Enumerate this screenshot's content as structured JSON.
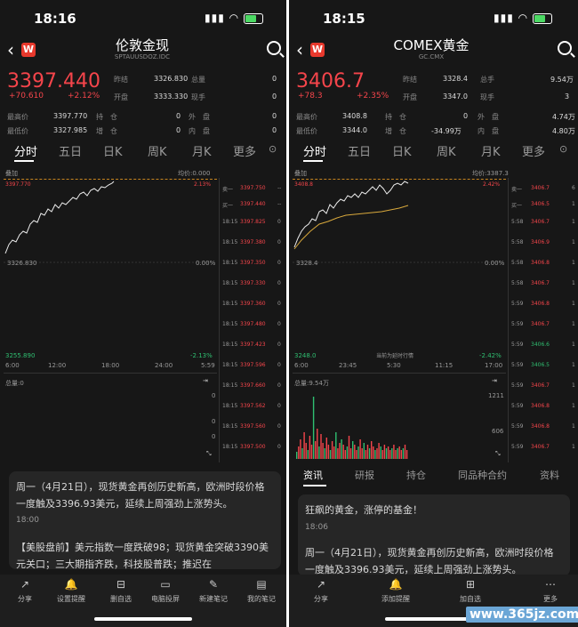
{
  "left": {
    "status_time": "18:16",
    "title": "伦敦金现",
    "subtitle": "SPTAUUSDOZ.IDC",
    "price": "3397.440",
    "change": "+70.610",
    "change_pct": "+2.12%",
    "stats": [
      {
        "label": "昨结",
        "value": "3326.830"
      },
      {
        "label": "总量",
        "value": "0"
      },
      {
        "label": "开盘",
        "value": "3333.330"
      },
      {
        "label": "现手",
        "value": "0"
      },
      {
        "label": "最高价",
        "value": "3397.770"
      },
      {
        "label": "持　仓",
        "value": "0"
      },
      {
        "label": "外　盘",
        "value": "0"
      },
      {
        "label": "最低价",
        "value": "3327.985"
      },
      {
        "label": "增　仓",
        "value": "0"
      },
      {
        "label": "内　盘",
        "value": "0"
      }
    ],
    "tabs": [
      "分时",
      "五日",
      "日K",
      "周K",
      "月K",
      "更多"
    ],
    "chart": {
      "overlay": "叠加",
      "avg": "均价:0.000",
      "hi": "3397.770",
      "hi_pct": "2.13%",
      "mid": "3326.830",
      "mid_pct": "0.00%",
      "lo": "3255.890",
      "lo_pct": "-2.13%",
      "xticks": [
        "6:00",
        "12:00",
        "18:00",
        "24:00",
        "5:59"
      ],
      "volume_label": "总量:0",
      "vol_ticks": [
        "0",
        "0",
        "0"
      ]
    },
    "bid_ask": [
      {
        "l": "卖一",
        "v": "3397.750",
        "r": "--"
      },
      {
        "l": "买一",
        "v": "3397.440",
        "r": "--"
      }
    ],
    "ticks": [
      {
        "t": "18:15",
        "v": "3397.825",
        "r": "0"
      },
      {
        "t": "18:15",
        "v": "3397.380",
        "r": "0"
      },
      {
        "t": "18:15",
        "v": "3397.350",
        "r": "0"
      },
      {
        "t": "18:15",
        "v": "3397.330",
        "r": "0"
      },
      {
        "t": "18:15",
        "v": "3397.360",
        "r": "0"
      },
      {
        "t": "18:15",
        "v": "3397.480",
        "r": "0"
      },
      {
        "t": "18:15",
        "v": "3397.423",
        "r": "0"
      },
      {
        "t": "18:15",
        "v": "3397.596",
        "r": "0"
      },
      {
        "t": "18:15",
        "v": "3397.660",
        "r": "0"
      },
      {
        "t": "18:15",
        "v": "3397.562",
        "r": "0"
      },
      {
        "t": "18:15",
        "v": "3397.560",
        "r": "0"
      },
      {
        "t": "18:15",
        "v": "3397.500",
        "r": "0"
      }
    ],
    "news1": "周一（4月21日），现货黄金再创历史新高，欧洲时段价格一度触及3396.93美元，延续上周强劲上涨势头。",
    "news1_time": "18:00",
    "news2": "【美股盘前】美元指数一度跌破98；现货黄金突破3390美元关口；三大期指齐跌，科技股普跌；推迟在",
    "bottom": [
      "分享",
      "设置提醒",
      "删自选",
      "电脑投屏",
      "新建笔记",
      "我的笔记"
    ]
  },
  "right": {
    "status_time": "18:15",
    "title": "COMEX黄金",
    "subtitle": "GC.CMX",
    "price": "3406.7",
    "change": "+78.3",
    "change_pct": "+2.35%",
    "stats": [
      {
        "label": "昨结",
        "value": "3328.4"
      },
      {
        "label": "总手",
        "value": "9.54万"
      },
      {
        "label": "开盘",
        "value": "3347.0"
      },
      {
        "label": "现手",
        "value": "3"
      },
      {
        "label": "最高价",
        "value": "3408.8"
      },
      {
        "label": "持　仓",
        "value": "0"
      },
      {
        "label": "外　盘",
        "value": "4.74万"
      },
      {
        "label": "最低价",
        "value": "3344.0"
      },
      {
        "label": "增　仓",
        "value": "-34.99万"
      },
      {
        "label": "内　盘",
        "value": "4.80万"
      }
    ],
    "tabs": [
      "分时",
      "五日",
      "日K",
      "周K",
      "月K",
      "更多"
    ],
    "chart": {
      "overlay": "叠加",
      "avg": "均价:3387.3",
      "hi": "3408.8",
      "hi_pct": "2.42%",
      "mid": "3328.4",
      "mid_pct": "0.00%",
      "lo": "3248.0",
      "lo_pct": "-2.42%",
      "xticks": [
        "6:00",
        "23:45",
        "5:30",
        "11:15",
        "17:00"
      ],
      "note": "当前为延时行情",
      "volume_label": "总量:9.54万",
      "vol_ticks": [
        "1211",
        "606"
      ]
    },
    "bid_ask": [
      {
        "l": "卖一",
        "v": "3406.7",
        "r": "6"
      },
      {
        "l": "买一",
        "v": "3406.5",
        "r": "1"
      }
    ],
    "ticks": [
      {
        "t": "5:58",
        "v": "3406.7",
        "r": "1"
      },
      {
        "t": "5:58",
        "v": "3406.9",
        "r": "1"
      },
      {
        "t": "5:58",
        "v": "3406.8",
        "r": "1"
      },
      {
        "t": "5:58",
        "v": "3406.7",
        "r": "1"
      },
      {
        "t": "5:59",
        "v": "3406.8",
        "r": "1"
      },
      {
        "t": "5:59",
        "v": "3406.7",
        "r": "1"
      },
      {
        "t": "5:59",
        "v": "3406.6",
        "r": "1"
      },
      {
        "t": "5:59",
        "v": "3406.5",
        "r": "1"
      },
      {
        "t": "5:59",
        "v": "3406.7",
        "r": "1"
      },
      {
        "t": "5:59",
        "v": "3406.8",
        "r": "1"
      },
      {
        "t": "5:59",
        "v": "3406.8",
        "r": "1"
      },
      {
        "t": "5:59",
        "v": "3406.7",
        "r": "1"
      }
    ],
    "sub_tabs": [
      "资讯",
      "研报",
      "持仓",
      "同品种合约",
      "资料"
    ],
    "news_title": "狂飙的黄金，涨停的基金！",
    "news_time": "18:06",
    "news_body": "周一（4月21日），现货黄金再创历史新高，欧洲时段价格一度触及3396.93美元，延续上周强劲上涨势头。",
    "bottom": [
      "分享",
      "添加提醒",
      "加自选",
      "更多"
    ]
  },
  "watermark": "www.365jz.com",
  "colors": {
    "up": "#f5454b",
    "down": "#2fbf71",
    "bg": "#171717",
    "panel": "#262626",
    "avg_line": "#d9a93c"
  }
}
